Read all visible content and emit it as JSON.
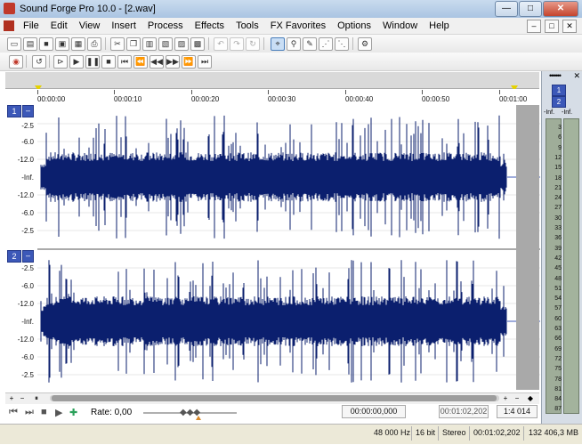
{
  "window": {
    "title": "Sound Forge Pro 10.0 - [2.wav]",
    "minimize": "—",
    "maximize": "□",
    "close": "✕"
  },
  "menu": [
    "File",
    "Edit",
    "View",
    "Insert",
    "Process",
    "Effects",
    "Tools",
    "FX Favorites",
    "Options",
    "Window",
    "Help"
  ],
  "menu_right": [
    "–",
    "□",
    "✕"
  ],
  "timeline": {
    "ticks": [
      "00:00:00",
      "00:00:10",
      "00:00:20",
      "00:00:30",
      "00:00:40",
      "00:00:50",
      "00:01:00"
    ]
  },
  "channels": [
    {
      "num": "1",
      "collapse": "–",
      "db_labels": [
        "-2.5",
        "-6.0",
        "-12.0",
        "-Inf.",
        "-12.0",
        "-6.0",
        "-2.5"
      ]
    },
    {
      "num": "2",
      "collapse": "–",
      "db_labels": [
        "-2.5",
        "-6.0",
        "-12.0",
        "-Inf.",
        "-12.0",
        "-6.0",
        "-2.5"
      ]
    }
  ],
  "transport": {
    "rate_label": "Rate: 0,00",
    "position": "00:00:00,000",
    "selection_end": "00:01:02,202",
    "zoom": "1:4 014"
  },
  "status": {
    "sample_rate": "48 000 Hz",
    "bit_depth": "16 bit",
    "channels": "Stereo",
    "length": "00:01:02,202",
    "disk": "132 406,3 MB"
  },
  "meter": {
    "dots": "••••••",
    "close": "✕",
    "ch1": "1",
    "ch2": "2",
    "peak1": "-Inf.",
    "peak2": "-Inf.",
    "scale": [
      "3",
      "6",
      "9",
      "12",
      "15",
      "18",
      "21",
      "24",
      "27",
      "30",
      "33",
      "36",
      "39",
      "42",
      "45",
      "48",
      "51",
      "54",
      "57",
      "60",
      "63",
      "66",
      "69",
      "72",
      "75",
      "78",
      "81",
      "84",
      "87"
    ]
  },
  "colors": {
    "waveform": "#0b1f6e",
    "channel_badge": "#3c58b8"
  }
}
